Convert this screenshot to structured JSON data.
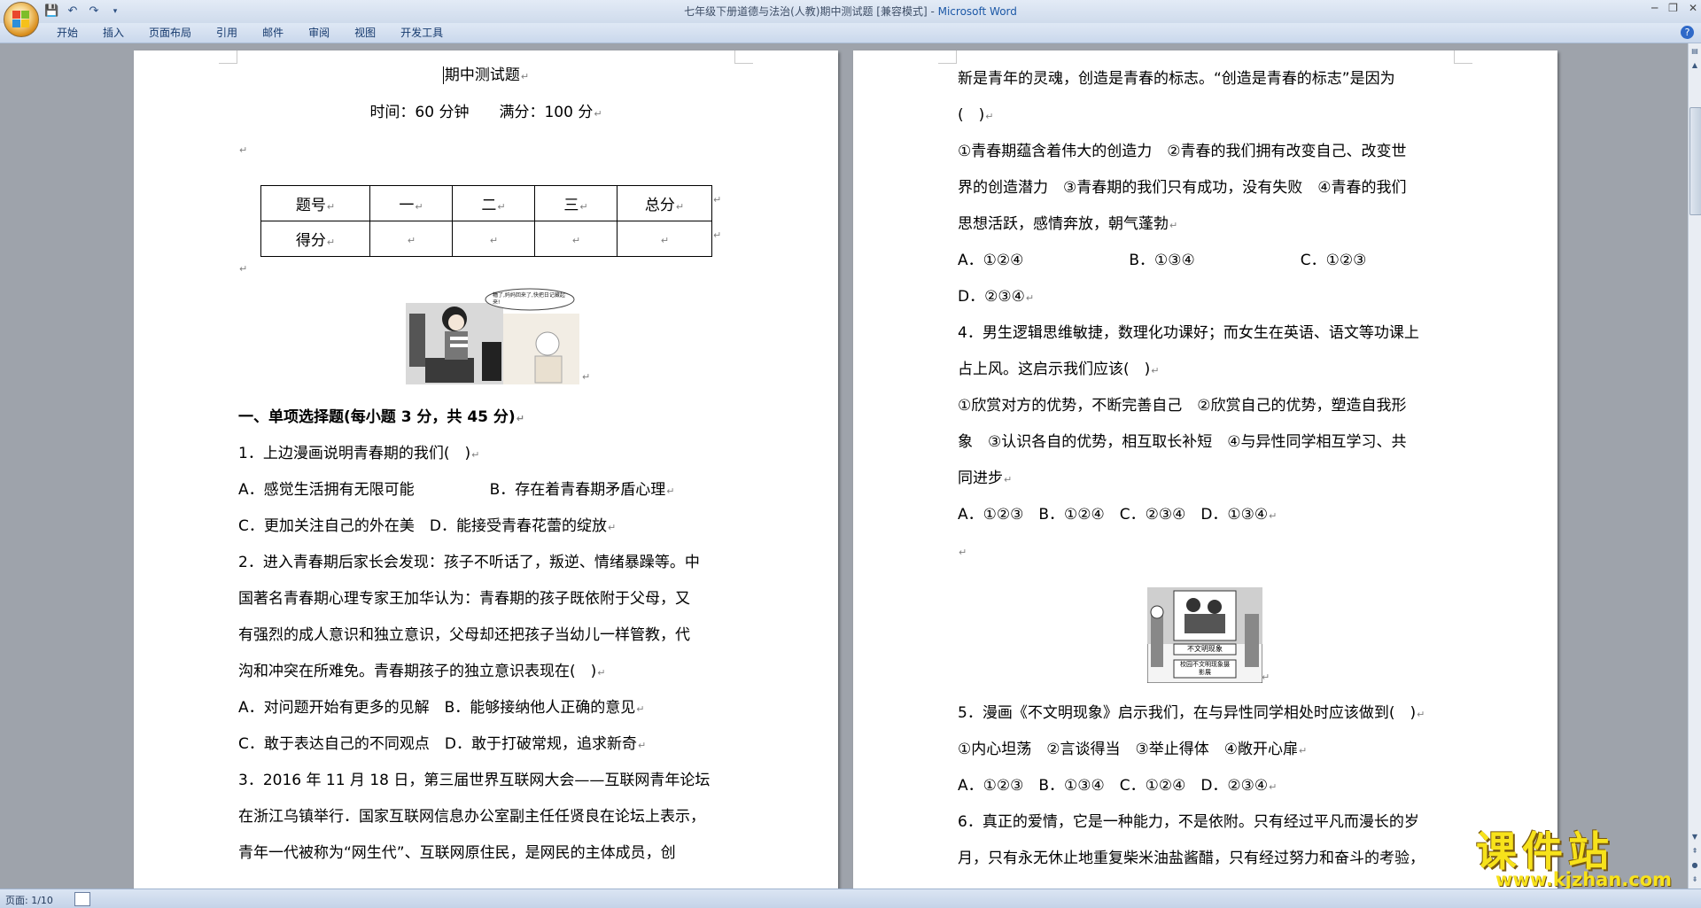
{
  "window": {
    "title": "七年级下册道德与法治(人教)期中测试题 [兼容模式] - ",
    "app_name": "Microsoft Word"
  },
  "ribbon": {
    "tabs": [
      "开始",
      "插入",
      "页面布局",
      "引用",
      "邮件",
      "审阅",
      "视图",
      "开发工具"
    ]
  },
  "page1": {
    "title": "期中测试题",
    "time_line": "时间：60 分钟　　满分：100 分",
    "table": {
      "header": [
        "题号",
        "一",
        "二",
        "三",
        "总分"
      ],
      "row_label": "得分"
    },
    "cartoon_caption": "糟了,妈妈回来了,快把日记藏起来!",
    "lines": [
      "一、单项选择题(每小题 3 分，共 45 分)",
      "1．上边漫画说明青春期的我们(　)",
      "A．感觉生活拥有无限可能　　　　　B．存在着青春期矛盾心理",
      "C．更加关注自己的外在美　D．能接受青春花蕾的绽放",
      "2．进入青春期后家长会发现：孩子不听话了，叛逆、情绪暴躁等。中",
      "国著名青春期心理专家王加华认为：青春期的孩子既依附于父母，又",
      "有强烈的成人意识和独立意识，父母却还把孩子当幼儿一样管教，代",
      "沟和冲突在所难免。青春期孩子的独立意识表现在(　)",
      "A．对问题开始有更多的见解　B．能够接纳他人正确的意见",
      "C．敢于表达自己的不同观点　D．敢于打破常规，追求新奇",
      "3．2016 年 11 月 18 日，第三届世界互联网大会——互联网青年论坛",
      "在浙江乌镇举行．国家互联网信息办公室副主任任贤良在论坛上表示，",
      "青年一代被称为“网生代”、互联网原住民，是网民的主体成员，创"
    ]
  },
  "page2": {
    "cartoon_caption_1": "不文明现象",
    "cartoon_caption_2": "校园不文明现象摄影展",
    "lines_top": [
      "新是青年的灵魂，创造是青春的标志。“创造是青春的标志”是因为",
      "(　)",
      "①青春期蕴含着伟大的创造力　②青春的我们拥有改变自己、改变世",
      "界的创造潜力　③青春期的我们只有成功，没有失败　④青春的我们",
      "思想活跃，感情奔放，朝气蓬勃",
      "A．①②④　　　　　　　B．①③④　　　　　　　C．①②③",
      "D．②③④",
      "4．男生逻辑思维敏捷，数理化功课好；而女生在英语、语文等功课上",
      "占上风。这启示我们应该(　)",
      "①欣赏对方的优势，不断完善自己　②欣赏自己的优势，塑造自我形",
      "象　③认识各自的优势，相互取长补短　④与异性同学相互学习、共",
      "同进步",
      "A．①②③　B．①②④　C．②③④　D．①③④"
    ],
    "lines_bottom": [
      "5．漫画《不文明现象》启示我们，在与异性同学相处时应该做到(　)",
      "①内心坦荡　②言谈得当　③举止得体　④敞开心扉",
      "A．①②③　B．①③④　C．①②④　D．②③④",
      "6．真正的爱情，它是一种能力，不是依附。只有经过平凡而漫长的岁",
      "月，只有永无休止地重复柴米油盐酱醋，只有经过努力和奋斗的考验，"
    ]
  },
  "status": {
    "page": "页面: 1/10"
  },
  "watermark": {
    "name": "课件站",
    "url": "www.kjzhan.com"
  }
}
